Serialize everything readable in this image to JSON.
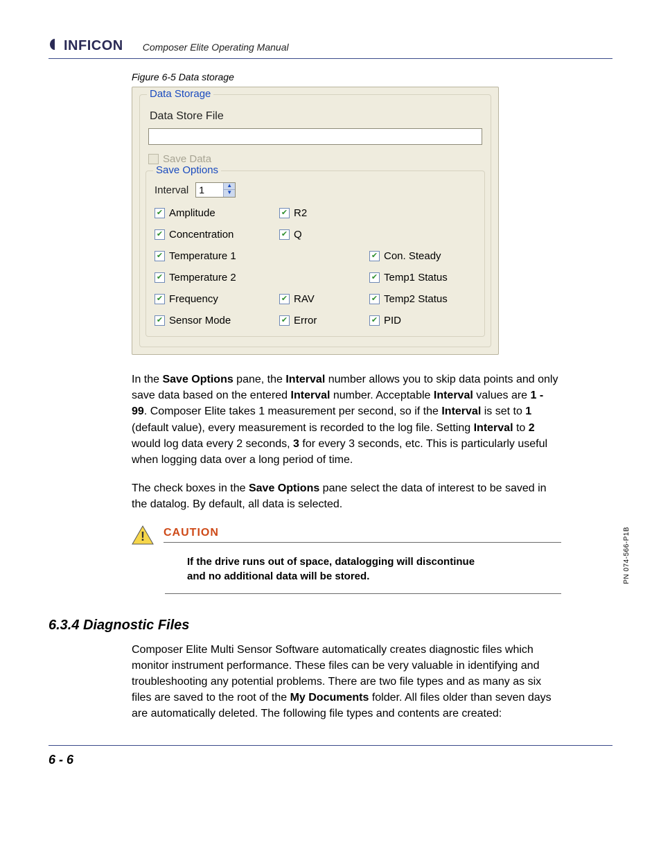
{
  "header": {
    "logo_text": "INFICON",
    "doc_title": "Composer Elite Operating Manual"
  },
  "figure_caption": "Figure 6-5  Data storage",
  "panel": {
    "group_data_storage": "Data Storage",
    "file_label": "Data Store File",
    "save_data_label": "Save Data",
    "group_save_options": "Save Options",
    "interval_label": "Interval",
    "interval_value": "1",
    "options": {
      "amplitude": "Amplitude",
      "r2": "R2",
      "concentration": "Concentration",
      "q": "Q",
      "temp1": "Temperature 1",
      "con_steady": "Con. Steady",
      "temp2": "Temperature 2",
      "temp1_status": "Temp1 Status",
      "frequency": "Frequency",
      "rav": "RAV",
      "temp2_status": "Temp2 Status",
      "sensor_mode": "Sensor Mode",
      "error": "Error",
      "pid": "PID"
    }
  },
  "para1_a": "In the ",
  "para1_b": "Save Options",
  "para1_c": " pane, the ",
  "para1_d": "Interval",
  "para1_e": " number allows you to skip data points and only save data based on the entered ",
  "para1_f": "Interval",
  "para1_g": " number. Acceptable ",
  "para1_h": "Interval",
  "para1_i": " values are ",
  "para1_j": "1 - 99",
  "para1_k": ". Composer Elite takes 1 measurement per second, so if the ",
  "para1_l": "Interval",
  "para1_m": " is set to ",
  "para1_n": "1",
  "para1_o": " (default value), every measurement is recorded to the log file. Setting ",
  "para1_p": "Interval",
  "para1_q": " to ",
  "para1_r": "2",
  "para1_s": " would log data every 2 seconds, ",
  "para1_t": "3",
  "para1_u": " for every 3 seconds, etc. This is particularly useful when logging data over a long period of time.",
  "para2_a": "The check boxes in the ",
  "para2_b": "Save Options",
  "para2_c": " pane select the data of interest to be saved in the datalog. By default, all data is selected.",
  "caution": {
    "label": "CAUTION",
    "text": "If the drive runs out of space, datalogging will discontinue and no additional data will be stored."
  },
  "section": {
    "heading": "6.3.4  Diagnostic Files",
    "body_a": "Composer Elite Multi Sensor Software automatically creates diagnostic files which monitor instrument performance. These files can be very valuable in identifying and troubleshooting any potential problems. There are two file types and as many as six files are saved to the root of the ",
    "body_b": "My Documents",
    "body_c": " folder. All files older than seven days are automatically deleted. The following file types and contents are created:"
  },
  "side_pn": "PN 074-566-P1B",
  "footer": "6 - 6"
}
